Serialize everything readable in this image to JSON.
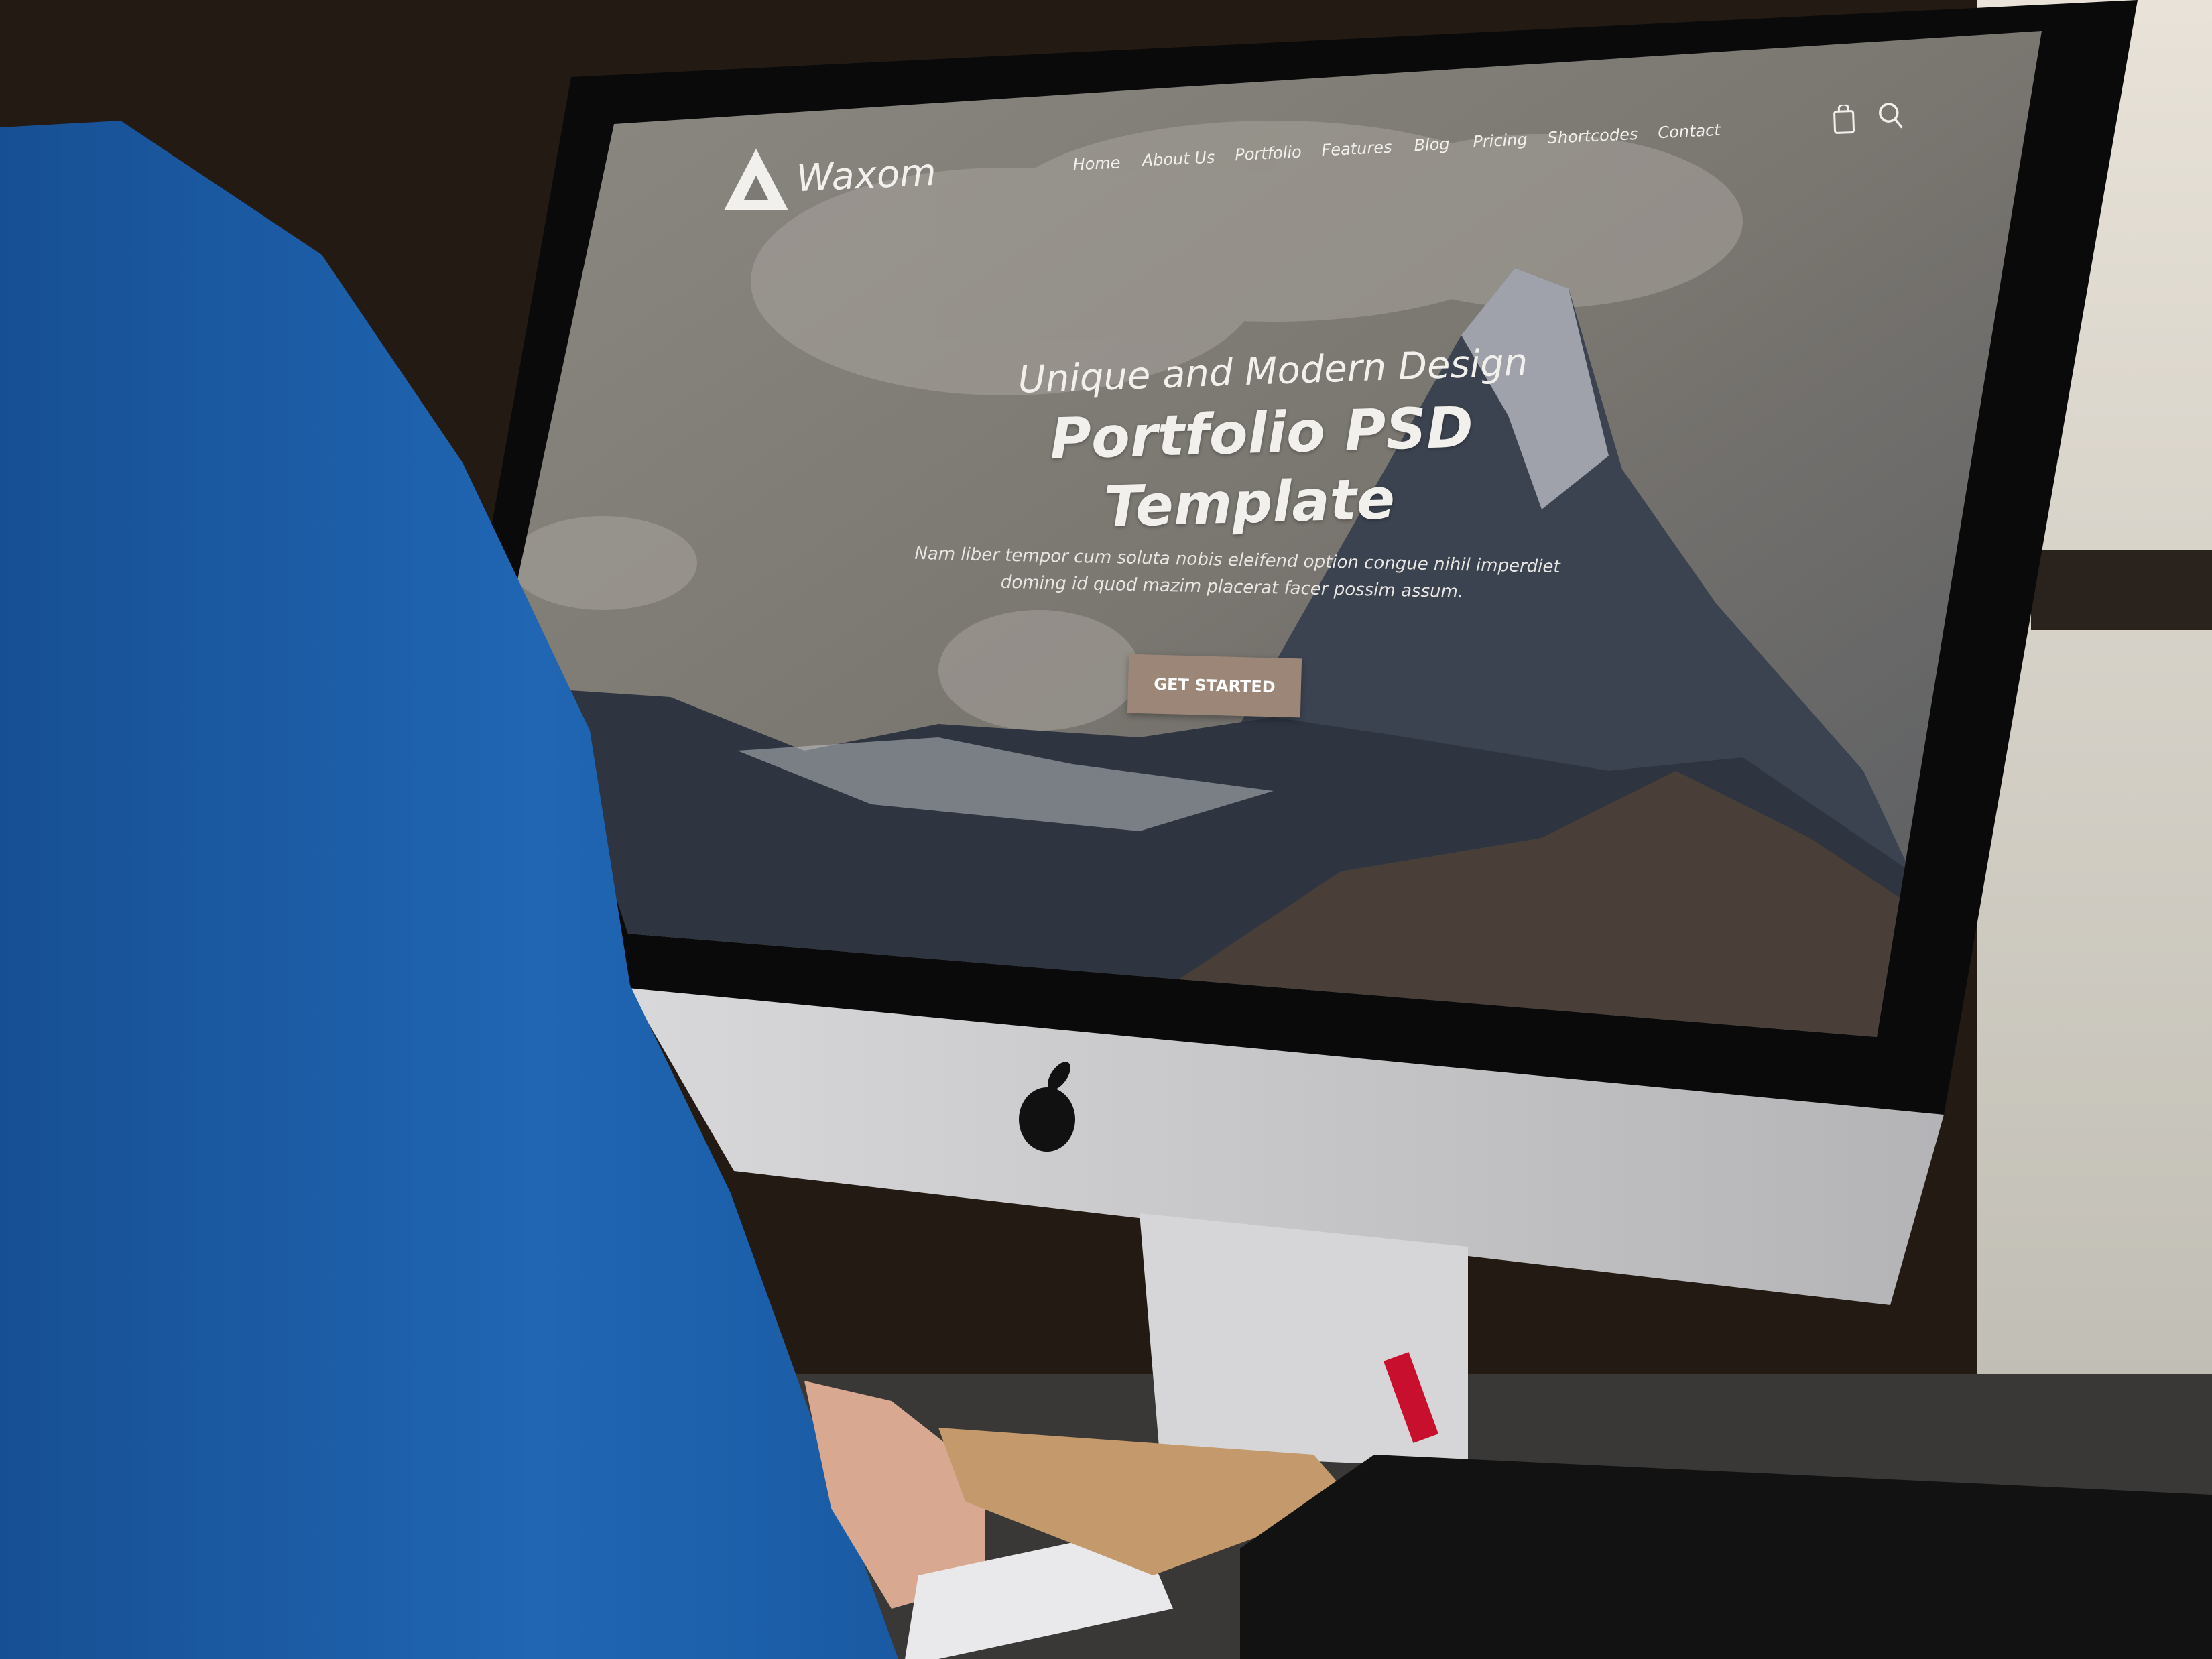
{
  "site": {
    "logo_text": "Waxom",
    "nav": [
      "Home",
      "About Us",
      "Portfolio",
      "Features",
      "Blog",
      "Pricing",
      "Shortcodes",
      "Contact"
    ],
    "icons": [
      "shopping-bag-icon",
      "search-icon"
    ]
  },
  "hero": {
    "subtitle": "Unique and Modern Design",
    "title_line1": "Portfolio PSD",
    "title_line2": "Template",
    "description_line1": "Nam liber tempor cum soluta nobis eleifend option congue nihil imperdiet",
    "description_line2": "doming id quod mazim placerat facer possim assum.",
    "cta_label": "GET STARTED"
  },
  "colors": {
    "accent": "#9b8677",
    "shirt": "#1f5fa8",
    "monitor_silver": "#c9c9cb"
  }
}
